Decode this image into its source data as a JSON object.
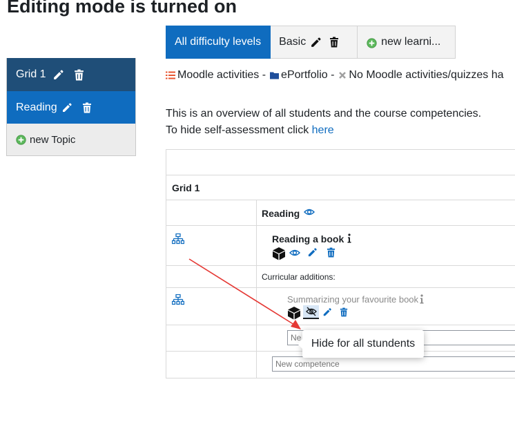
{
  "page": {
    "title": "Editing mode is turned on"
  },
  "nav": {
    "items": [
      {
        "label": "Grid 1"
      },
      {
        "label": "Reading"
      },
      {
        "label": "new Topic"
      }
    ]
  },
  "tabs": {
    "all": "All difficulty levels",
    "basic": "Basic",
    "new_learning": "new learni..."
  },
  "legend": {
    "moodle_activities": "Moodle activities -",
    "eportfolio": "ePortfolio -",
    "no_activities": "No Moodle activities/quizzes ha"
  },
  "overview": {
    "line1": "This is an overview of all students and the course competencies.",
    "line2_prefix": "To hide self-assessment click",
    "here_link": "here"
  },
  "table": {
    "group_title": "Grid 1",
    "subject": "Reading",
    "competence": "Reading a book",
    "curricular_label": "Curricular additions:",
    "addition": "Summarizing your favourite book",
    "input_placeholder_1": "Ne",
    "input_placeholder_2": "New competence"
  },
  "tooltip": {
    "text": "Hide for all stundents"
  },
  "colors": {
    "accent": "#0f6cbf",
    "nav_dark": "#1f4e78",
    "add_green": "#5cb85c",
    "legend_list": "#e8542f",
    "annotation_arrow": "#e53935"
  }
}
